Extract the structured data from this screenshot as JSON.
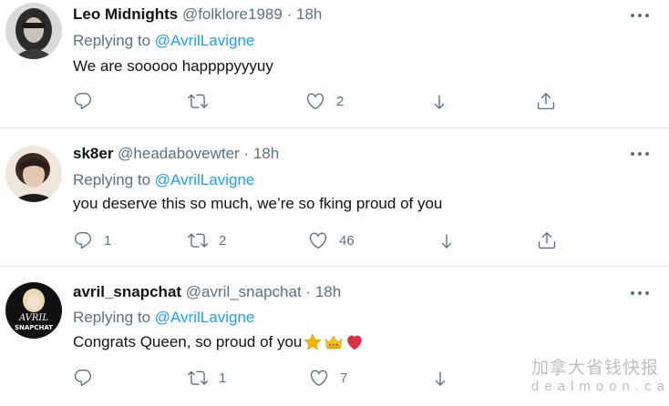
{
  "tweets": [
    {
      "display_name": "Leo Midnights",
      "handle": "@folklore1989",
      "separator": "·",
      "time": "18h",
      "replying_to_label": "Replying to",
      "replying_to": "@AvrilLavigne",
      "text": "We are sooooo happppyyyuy",
      "reply_count": "",
      "retweet_count": "",
      "like_count": "2"
    },
    {
      "display_name": "sk8er",
      "handle": "@headabovewter",
      "separator": "·",
      "time": "18h",
      "replying_to_label": "Replying to",
      "replying_to": "@AvrilLavigne",
      "text": "you deserve this so much, we’re so fking proud of you",
      "reply_count": "1",
      "retweet_count": "2",
      "like_count": "46"
    },
    {
      "display_name": "avril_snapchat",
      "handle": "@avril_snapchat",
      "separator": "·",
      "time": "18h",
      "replying_to_label": "Replying to",
      "replying_to": "@AvrilLavigne",
      "text": "Congrats Queen, so proud of you",
      "reply_count": "",
      "retweet_count": "1",
      "like_count": "7",
      "avatar_logo_text": [
        "AVRIL",
        "SNAPCHAT"
      ]
    }
  ],
  "icons": [
    "reply-icon",
    "retweet-icon",
    "like-icon",
    "share-icon",
    "upload-icon",
    "more-icon",
    "star-emoji",
    "crown-emoji",
    "heart-emoji"
  ],
  "watermark": {
    "chinese": "加拿大省钱快报",
    "domain": "dealmoon.ca"
  },
  "colors": {
    "link": "#1da1f2",
    "secondary_text": "#5b7083",
    "primary_text": "#0f1419",
    "divider": "#e6ecf0"
  }
}
